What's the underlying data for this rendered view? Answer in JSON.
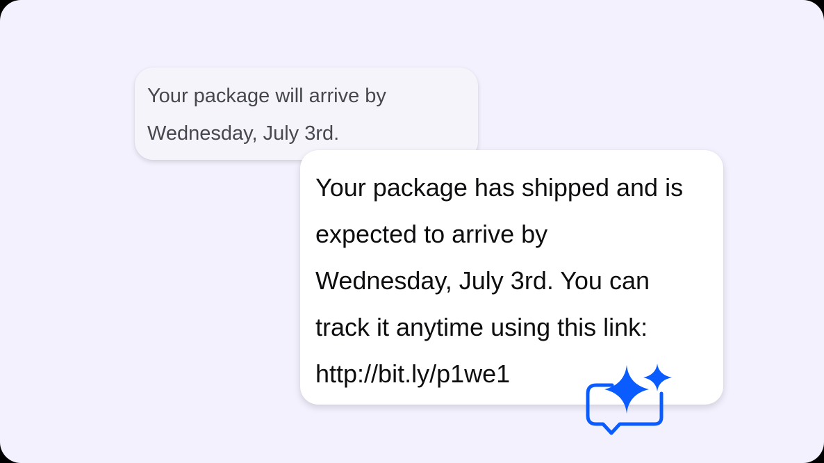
{
  "original_message": {
    "lines": [
      "Your package will arrive by",
      "Wednesday, July 3rd."
    ]
  },
  "rewritten_message": {
    "lines": [
      "Your package has shipped and is",
      "expected to arrive by",
      "Wednesday, July 3rd. You can",
      "track it anytime using this link:",
      "http://bit.ly/p1we1"
    ]
  },
  "icons": {
    "ai_badge": "sparkle-chat-bubble-icon"
  },
  "colors": {
    "background": "#f2f1fd",
    "original_bubble": "#f5f4fb",
    "rewritten_bubble": "#ffffff",
    "accent": "#0b5cff"
  }
}
